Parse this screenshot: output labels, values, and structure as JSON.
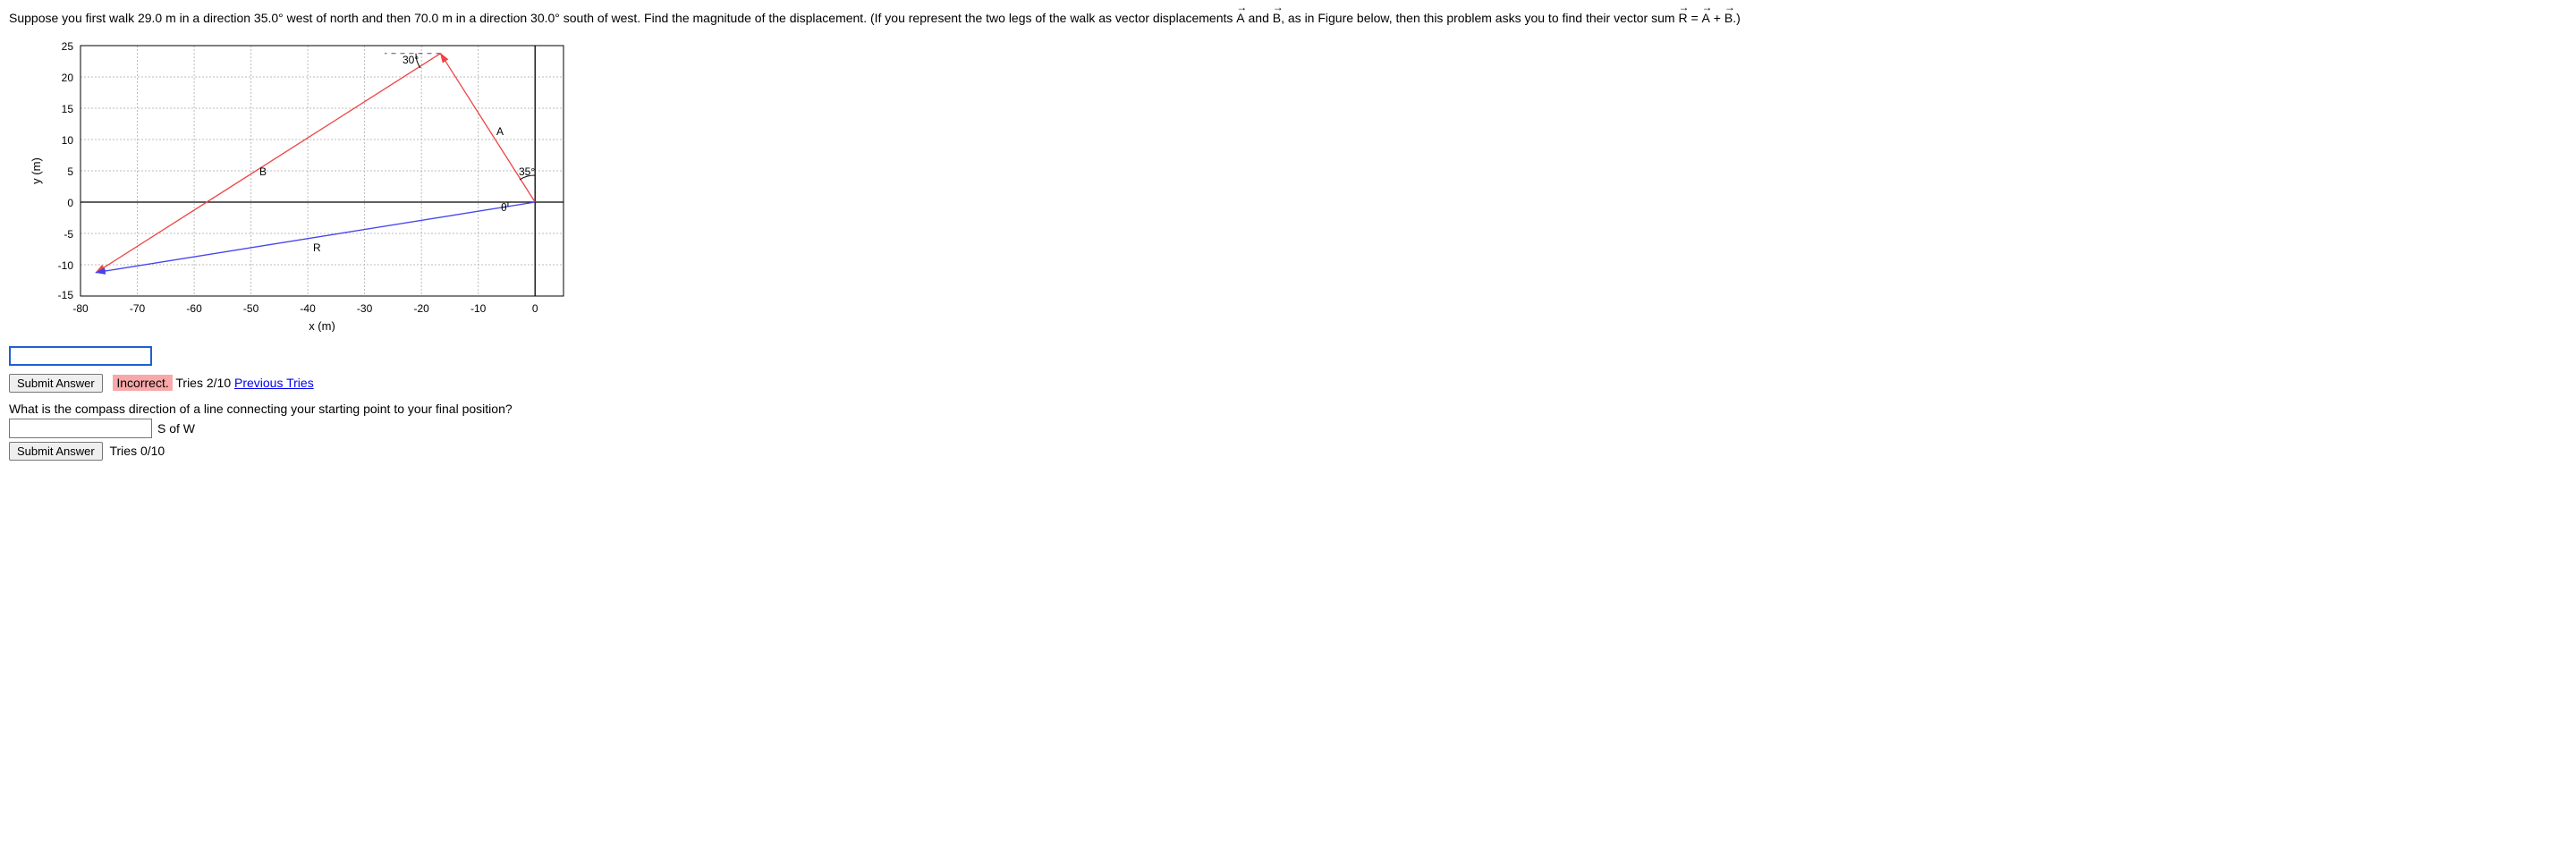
{
  "question": {
    "part1_text_a": "Suppose you first walk 29.0 m in a direction 35.0° west of north and then 70.0 m in a direction 30.0° south of west. Find the magnitude of the displacement. (If you represent the two legs of the walk as vector displacements ",
    "vec_a": "A",
    "part1_text_b": " and ",
    "vec_b": "B",
    "part1_text_c": ", as in Figure below, then this problem asks you to find their vector sum ",
    "vec_r": "R",
    "equals": " = ",
    "plus": " + ",
    "period_close": ".)"
  },
  "chart_data": {
    "type": "line",
    "xlabel": "x (m)",
    "ylabel": "y (m)",
    "xlim": [
      -80,
      5
    ],
    "ylim": [
      -15,
      25
    ],
    "x_ticks": [
      -80,
      -70,
      -60,
      -50,
      -40,
      -30,
      -20,
      -10,
      0
    ],
    "y_ticks": [
      -15,
      -10,
      -5,
      0,
      5,
      10,
      15,
      20,
      25
    ],
    "vectors": {
      "A": {
        "start": [
          0,
          0
        ],
        "end": [
          -16.64,
          23.76
        ],
        "color": "#ee4444",
        "label": "A",
        "angle_label": "35°"
      },
      "B": {
        "start": [
          -16.64,
          23.76
        ],
        "end": [
          -77.26,
          -11.24
        ],
        "color": "#ee4444",
        "label": "B",
        "angle_label": "30°"
      },
      "R": {
        "start": [
          0,
          0
        ],
        "end": [
          -77.26,
          -11.24
        ],
        "color": "#4444ee",
        "label": "R"
      }
    },
    "angle_30": "30°",
    "angle_35": "35°"
  },
  "q1": {
    "submit_label": "Submit Answer",
    "incorrect_label": "Incorrect.",
    "tries_label": "Tries 2/10 ",
    "previous_label": "Previous Tries"
  },
  "q2": {
    "question_text": "What is the compass direction of a line connecting your starting point to your final position?",
    "unit": "S of W",
    "submit_label": "Submit Answer",
    "tries_label": "Tries 0/10"
  }
}
